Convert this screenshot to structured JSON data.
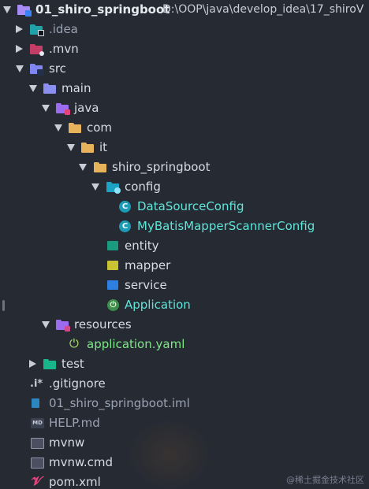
{
  "project": {
    "name": "01_shiro_springboot",
    "path": "D:\\OOP\\java\\develop_idea\\17_shiroV"
  },
  "nodes": [
    {
      "label": "01_shiro_springboot",
      "icon": "project-folder-icon"
    },
    {
      "label": ".idea",
      "icon": "idea-folder-icon"
    },
    {
      "label": ".mvn",
      "icon": "mvn-folder-icon"
    },
    {
      "label": "src",
      "icon": "src-folder-icon"
    },
    {
      "label": "main",
      "icon": "folder-icon"
    },
    {
      "label": "java",
      "icon": "java-source-folder-icon"
    },
    {
      "label": "com",
      "icon": "package-folder-icon"
    },
    {
      "label": "it",
      "icon": "package-folder-icon"
    },
    {
      "label": "shiro_springboot",
      "icon": "package-folder-icon"
    },
    {
      "label": "config",
      "icon": "config-package-icon"
    },
    {
      "label": "DataSourceConfig",
      "icon": "class-icon"
    },
    {
      "label": "MyBatisMapperScannerConfig",
      "icon": "class-icon"
    },
    {
      "label": "entity",
      "icon": "entity-package-icon"
    },
    {
      "label": "mapper",
      "icon": "mapper-package-icon"
    },
    {
      "label": "service",
      "icon": "service-package-icon"
    },
    {
      "label": "Application",
      "icon": "spring-boot-class-icon"
    },
    {
      "label": "resources",
      "icon": "resources-folder-icon"
    },
    {
      "label": "application.yaml",
      "icon": "spring-config-icon"
    },
    {
      "label": "test",
      "icon": "test-folder-icon"
    },
    {
      "label": ".gitignore",
      "icon": "gitignore-icon"
    },
    {
      "label": "01_shiro_springboot.iml",
      "icon": "iml-file-icon"
    },
    {
      "label": "HELP.md",
      "icon": "markdown-file-icon"
    },
    {
      "label": "mvnw",
      "icon": "terminal-file-icon"
    },
    {
      "label": "mvnw.cmd",
      "icon": "terminal-file-icon"
    },
    {
      "label": "pom.xml",
      "icon": "maven-icon"
    }
  ],
  "icons": {
    "gitignore_text": ".i*",
    "markdown_text": "MD",
    "class_letter": "C"
  },
  "watermark": "@稀土掘金技术社区",
  "colors": {
    "background": "#262a33",
    "folder": "#8b8ff0",
    "package": "#e6b35c",
    "class": "#1d9bb5",
    "file_green": "#7ee787",
    "class_text": "#5ee6d9"
  }
}
